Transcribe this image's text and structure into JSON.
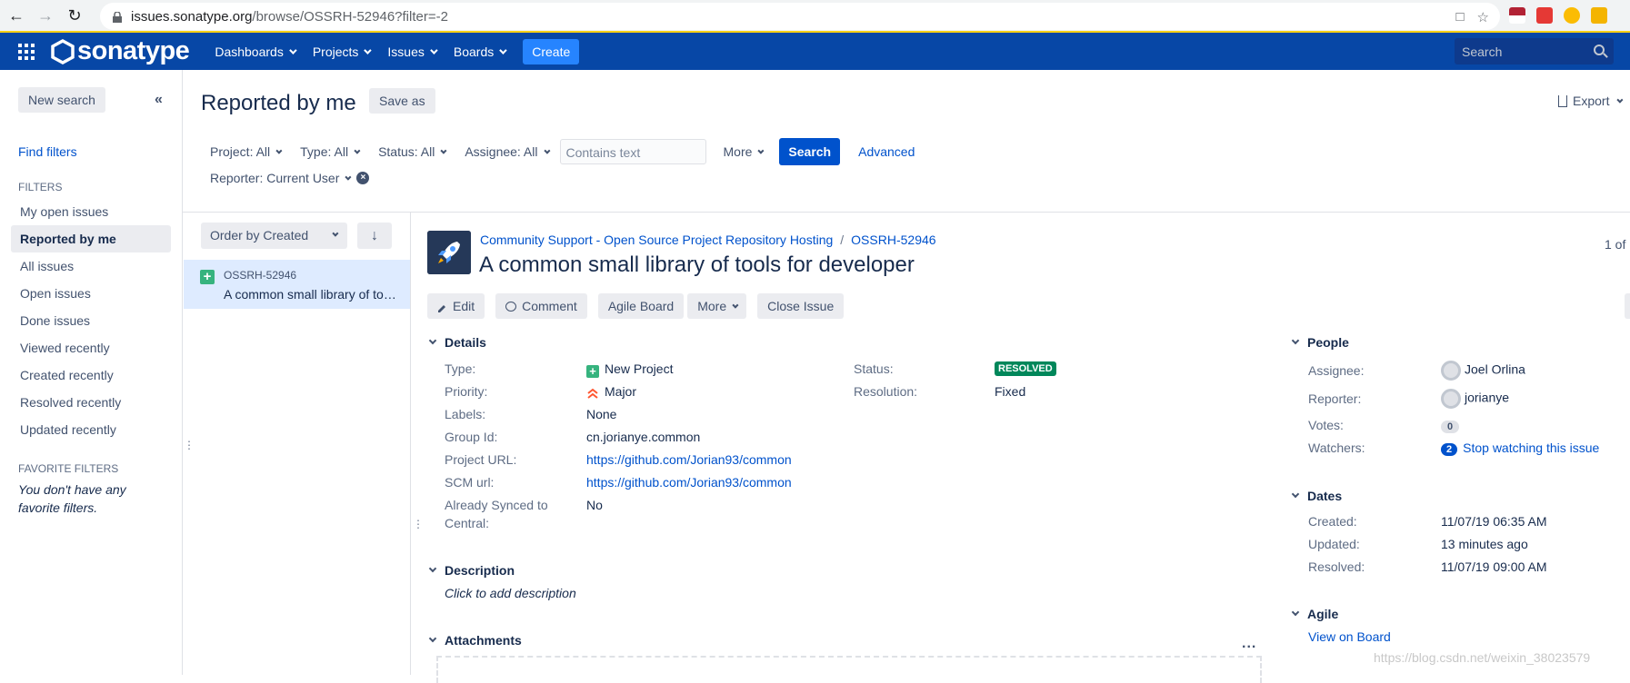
{
  "browser": {
    "url_host": "issues.sonatype.org",
    "url_path": "/browse/OSSRH-52946?filter=-2"
  },
  "topnav": {
    "logo_text": "sonatype",
    "items": [
      "Dashboards",
      "Projects",
      "Issues",
      "Boards"
    ],
    "create_label": "Create",
    "search_placeholder": "Search"
  },
  "sidebar": {
    "new_search": "New search",
    "find_filters": "Find filters",
    "filters_heading": "FILTERS",
    "filters": [
      "My open issues",
      "Reported by me",
      "All issues",
      "Open issues",
      "Done issues",
      "Viewed recently",
      "Created recently",
      "Resolved recently",
      "Updated recently"
    ],
    "favorite_heading": "FAVORITE FILTERS",
    "favorite_note": "You don't have any favorite filters."
  },
  "header": {
    "title": "Reported by me",
    "save_as": "Save as",
    "export": "Export"
  },
  "criteria": {
    "project": "Project: All",
    "type": "Type: All",
    "status": "Status: All",
    "assignee": "Assignee: All",
    "contains_placeholder": "Contains text",
    "more": "More",
    "search": "Search",
    "advanced": "Advanced",
    "reporter": "Reporter: Current User"
  },
  "list": {
    "order_by": "Order by Created",
    "order_dir_icon": "arrow-down-icon",
    "rows": [
      {
        "key": "OSSRH-52946",
        "summary": "A common small library of tools for developer"
      }
    ]
  },
  "issue": {
    "project": "Community Support - Open Source Project Repository Hosting",
    "key": "OSSRH-52946",
    "title": "A common small library of tools for developer",
    "pager": "1 of",
    "actions": {
      "edit": "Edit",
      "comment": "Comment",
      "agile_board": "Agile Board",
      "more": "More",
      "close": "Close Issue"
    },
    "details_heading": "Details",
    "details": {
      "type_label": "Type:",
      "type_value": "New Project",
      "priority_label": "Priority:",
      "priority_value": "Major",
      "labels_label": "Labels:",
      "labels_value": "None",
      "group_label": "Group Id:",
      "group_value": "cn.jorianye.common",
      "project_url_label": "Project URL:",
      "project_url_value": "https://github.com/Jorian93/common",
      "scm_label": "SCM url:",
      "scm_value": "https://github.com/Jorian93/common",
      "synced_label_1": "Already Synced to",
      "synced_label_2": "Central:",
      "synced_value": "No",
      "status_label": "Status:",
      "status_value": "RESOLVED",
      "resolution_label": "Resolution:",
      "resolution_value": "Fixed"
    },
    "description_heading": "Description",
    "description_placeholder": "Click to add description",
    "attachments_heading": "Attachments",
    "attachments_more": "...",
    "people_heading": "People",
    "people": {
      "assignee_label": "Assignee:",
      "assignee": "Joel Orlina",
      "reporter_label": "Reporter:",
      "reporter": "jorianye",
      "votes_label": "Votes:",
      "votes": "0",
      "watchers_label": "Watchers:",
      "watchers": "2",
      "watch_link": "Stop watching this issue"
    },
    "dates_heading": "Dates",
    "dates": {
      "created_label": "Created:",
      "created": "11/07/19 06:35 AM",
      "updated_label": "Updated:",
      "updated": "13 minutes ago",
      "resolved_label": "Resolved:",
      "resolved": "11/07/19 09:00 AM"
    },
    "agile_heading": "Agile",
    "agile_link": "View on Board"
  },
  "watermark": "https://blog.csdn.net/weixin_38023579",
  "colors": {
    "nav": "#0747a6",
    "accent": "#0052cc",
    "resolved": "#00875a",
    "chrome_border": "#fcd116"
  }
}
